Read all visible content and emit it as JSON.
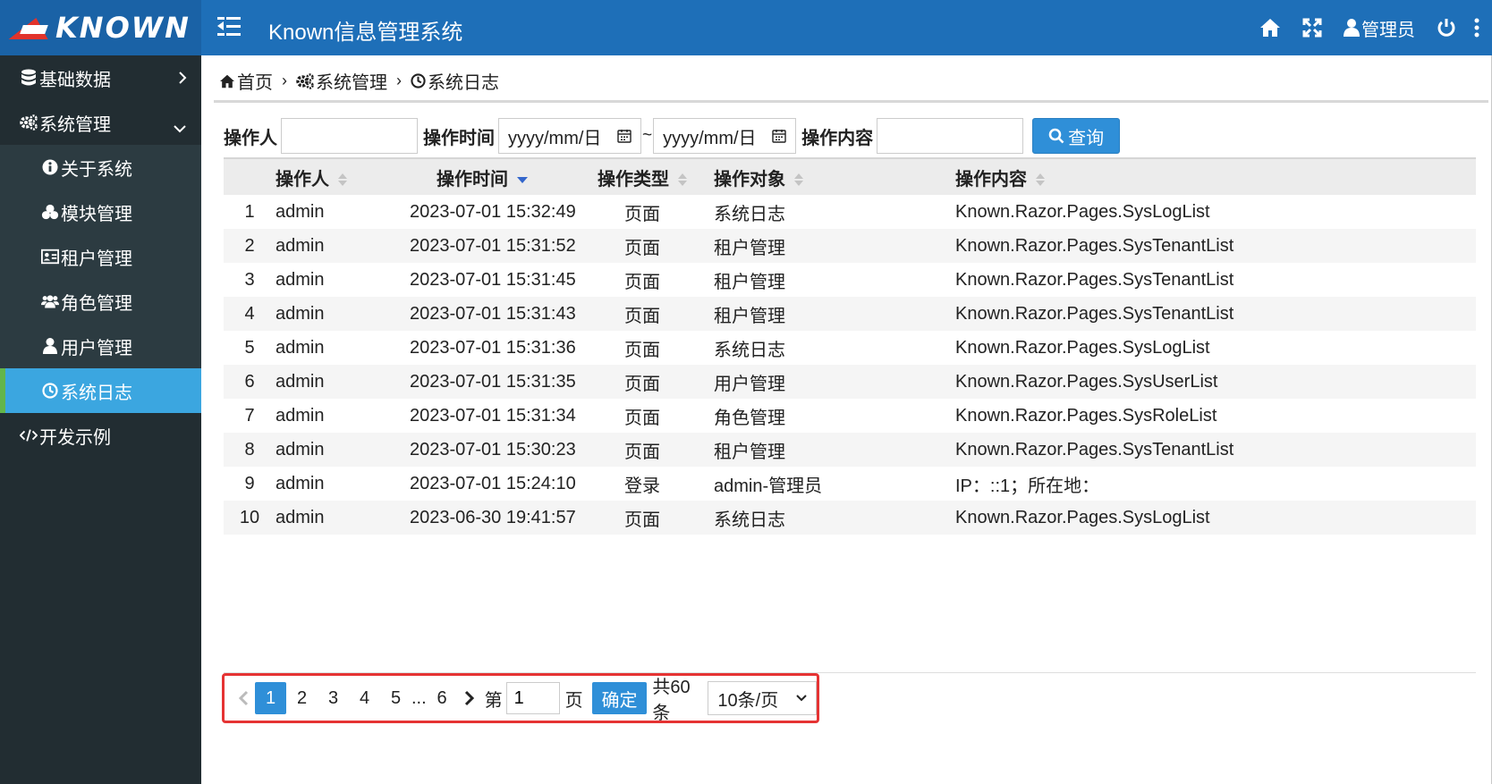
{
  "header": {
    "logo_text": "KNOWN",
    "title": "Known信息管理系统",
    "user_label": "管理员",
    "icons": [
      "menu-icon",
      "home-icon",
      "fullscreen-icon",
      "user-icon",
      "power-icon",
      "more-vertical-icon"
    ],
    "brand_color": "#1e6fb8"
  },
  "sidebar": {
    "items": [
      {
        "label": "基础数据",
        "icon": "database-icon"
      },
      {
        "label": "系统管理",
        "icon": "cogs-icon"
      }
    ],
    "sub_items": [
      {
        "label": "关于系统",
        "icon": "info-icon"
      },
      {
        "label": "模块管理",
        "icon": "cubes-icon"
      },
      {
        "label": "租户管理",
        "icon": "id-card-icon"
      },
      {
        "label": "角色管理",
        "icon": "users-icon"
      },
      {
        "label": "用户管理",
        "icon": "user-icon"
      },
      {
        "label": "系统日志",
        "icon": "clock-icon",
        "active": true
      }
    ],
    "dev_item": {
      "label": "开发示例",
      "icon": "code-icon"
    },
    "active_color": "#3ba6e0"
  },
  "breadcrumb": [
    "首页",
    "系统管理",
    "系统日志"
  ],
  "search": {
    "operator_label": "操作人",
    "operator_value": "",
    "time_label": "操作时间",
    "date_start_placeholder": "yyyy/mm/日",
    "date_separator": "~",
    "date_end_placeholder": "yyyy/mm/日",
    "content_label": "操作内容",
    "content_value": "",
    "query_label": "查询"
  },
  "table": {
    "columns": [
      "",
      "操作人",
      "操作时间",
      "操作类型",
      "操作对象",
      "操作内容"
    ],
    "sorted_column": "操作时间",
    "sort_direction": "desc",
    "rows": [
      [
        "1",
        "admin",
        "2023-07-01 15:32:49",
        "页面",
        "系统日志",
        "Known.Razor.Pages.SysLogList"
      ],
      [
        "2",
        "admin",
        "2023-07-01 15:31:52",
        "页面",
        "租户管理",
        "Known.Razor.Pages.SysTenantList"
      ],
      [
        "3",
        "admin",
        "2023-07-01 15:31:45",
        "页面",
        "租户管理",
        "Known.Razor.Pages.SysTenantList"
      ],
      [
        "4",
        "admin",
        "2023-07-01 15:31:43",
        "页面",
        "租户管理",
        "Known.Razor.Pages.SysTenantList"
      ],
      [
        "5",
        "admin",
        "2023-07-01 15:31:36",
        "页面",
        "系统日志",
        "Known.Razor.Pages.SysLogList"
      ],
      [
        "6",
        "admin",
        "2023-07-01 15:31:35",
        "页面",
        "用户管理",
        "Known.Razor.Pages.SysUserList"
      ],
      [
        "7",
        "admin",
        "2023-07-01 15:31:34",
        "页面",
        "角色管理",
        "Known.Razor.Pages.SysRoleList"
      ],
      [
        "8",
        "admin",
        "2023-07-01 15:30:23",
        "页面",
        "租户管理",
        "Known.Razor.Pages.SysTenantList"
      ],
      [
        "9",
        "admin",
        "2023-07-01 15:24:10",
        "登录",
        "admin-管理员",
        "IP：::1；所在地："
      ],
      [
        "10",
        "admin",
        "2023-06-30 19:41:57",
        "页面",
        "系统日志",
        "Known.Razor.Pages.SysLogList"
      ]
    ]
  },
  "pager": {
    "pages": [
      "1",
      "2",
      "3",
      "4",
      "5",
      "...",
      "6"
    ],
    "current_page": "1",
    "goto_prefix": "第",
    "goto_value": "1",
    "goto_suffix": "页",
    "confirm_label": "确定",
    "total_label": "共60条",
    "page_size": "10条/页",
    "highlight_color": "#e53333"
  }
}
